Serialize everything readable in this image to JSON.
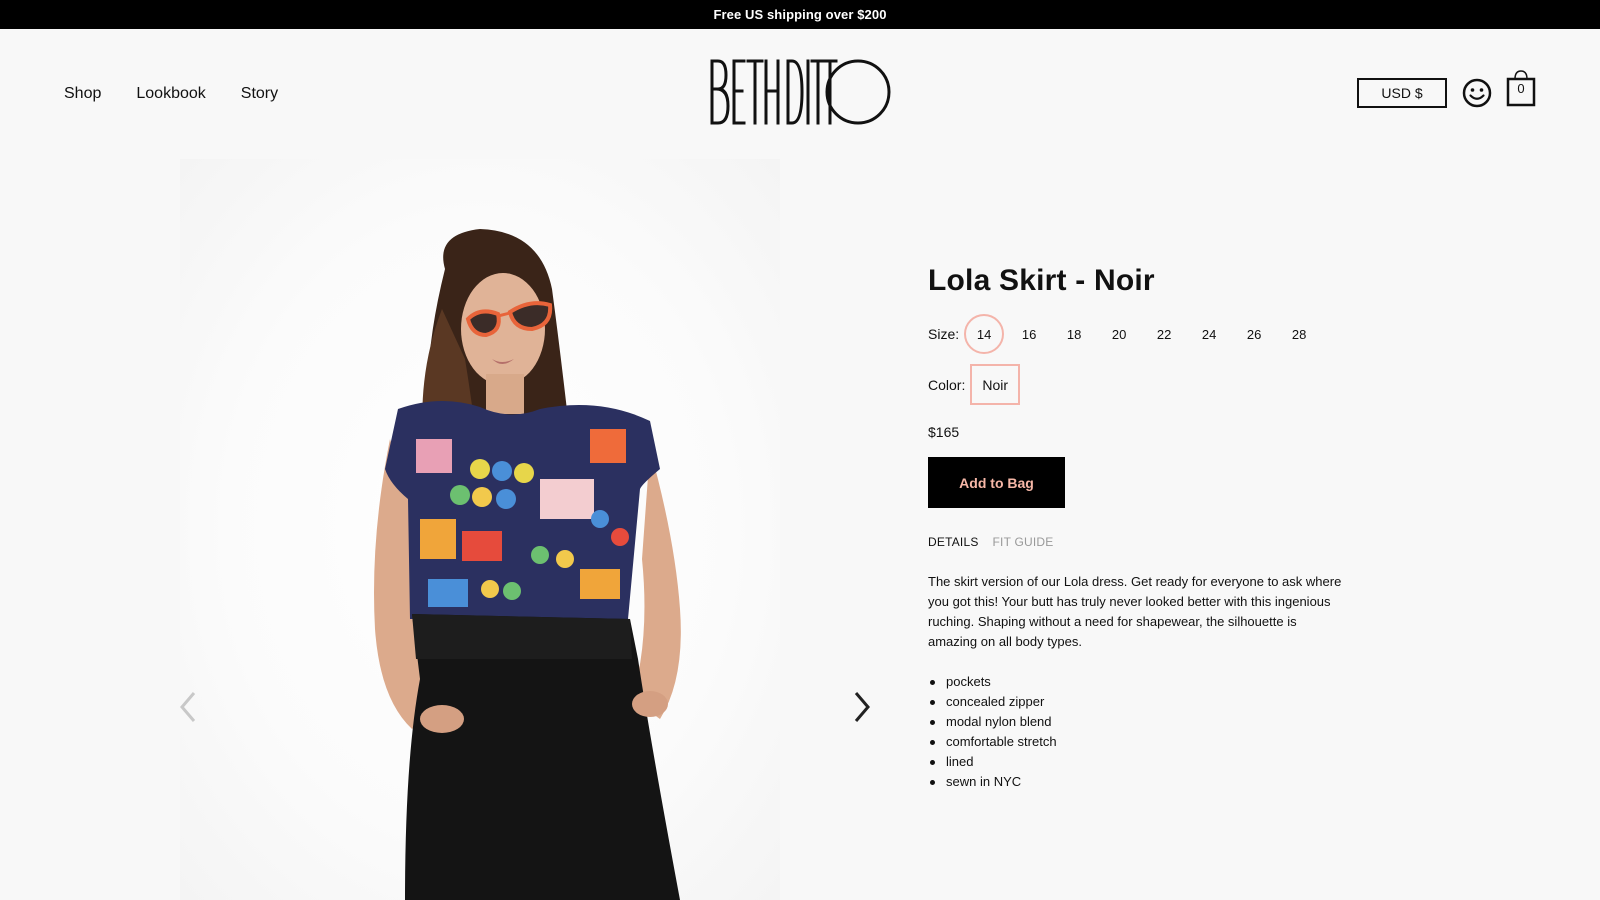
{
  "promo": {
    "text": "Free US shipping over $200"
  },
  "nav": {
    "items": [
      "Shop",
      "Lookbook",
      "Story"
    ]
  },
  "brand": {
    "logo_text": "BETH DITTO"
  },
  "header": {
    "currency_label": "USD $",
    "bag_count": "0"
  },
  "product": {
    "title": "Lola Skirt - Noir",
    "size_label": "Size:",
    "sizes": [
      "14",
      "16",
      "18",
      "20",
      "22",
      "24",
      "26",
      "28"
    ],
    "selected_size": "14",
    "color_label": "Color:",
    "color_value": "Noir",
    "price": "$165",
    "add_to_bag": "Add to Bag",
    "tabs": [
      "DETAILS",
      "FIT GUIDE"
    ],
    "active_tab": "DETAILS",
    "description": "The skirt version of our Lola dress. Get ready for everyone to ask where you got this! Your butt has truly never looked better with this ingenious ruching. Shaping without a need for shapewear, the silhouette is amazing on all body types.",
    "features": [
      "pockets",
      "concealed zipper",
      "modal nylon blend",
      "comfortable stretch",
      "lined",
      "sewn in NYC"
    ]
  },
  "gallery": {
    "prev_icon": "chevron-left-icon",
    "next_icon": "chevron-right-icon"
  },
  "colors": {
    "accent": "#f4b4aa",
    "button_text": "#f6b7a7",
    "dark": "#000000"
  }
}
